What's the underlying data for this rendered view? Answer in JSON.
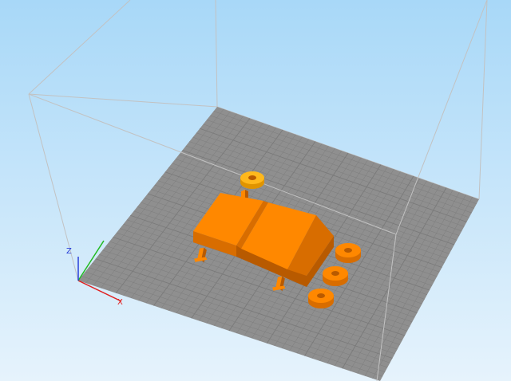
{
  "viewport": {
    "background_top": "#a8d8f8",
    "background_bottom": "#e6f3fc",
    "build_volume_color": "#c2c2c2",
    "bed_color": "#8f8f8f",
    "grid_line_color": "#7a7a7a"
  },
  "axes": {
    "x": {
      "label": "X",
      "color": "#e02020",
      "icon": "x-axis-arrow"
    },
    "y": {
      "label": "",
      "color": "#22bb22",
      "icon": "y-axis-arrow"
    },
    "z": {
      "label": "Z",
      "color": "#2a3fd8",
      "icon": "z-axis-arrow"
    }
  },
  "objects": {
    "main_color": "#ff8800",
    "main_shadow": "#d86d00",
    "main_dark": "#b85a00",
    "selected_color": "#ffb81c",
    "selected_shadow": "#e09400",
    "ring_count": 4,
    "pin_count": 3
  }
}
